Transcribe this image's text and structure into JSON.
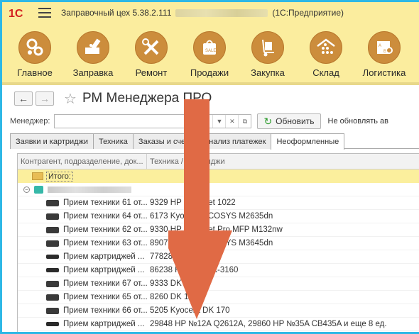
{
  "app": {
    "title": "Заправочный цех 5.38.2.111",
    "suffix": "(1С:Предприятие)"
  },
  "sections": [
    {
      "label": "Главное",
      "icon": "gears-icon"
    },
    {
      "label": "Заправка",
      "icon": "printer-refill-icon"
    },
    {
      "label": "Ремонт",
      "icon": "tools-icon"
    },
    {
      "label": "Продажи",
      "icon": "sale-bag-icon"
    },
    {
      "label": "Закупка",
      "icon": "hand-truck-icon"
    },
    {
      "label": "Склад",
      "icon": "warehouse-icon"
    },
    {
      "label": "Логистика",
      "icon": "map-pin-icon"
    }
  ],
  "form": {
    "title": "РМ Менеджера ПРО",
    "manager_label": "Менеджер:",
    "manager_value": "",
    "refresh_label": "Обновить",
    "no_update_label": "Не обновлять ав"
  },
  "tabs": [
    "Заявки и картриджи",
    "Техника",
    "Заказы и счета",
    "Анализ платежек",
    "Неоформленные"
  ],
  "active_tab": 4,
  "grid": {
    "columns": [
      "Контрагент, подразделение, док...",
      "Техника / Картриджи"
    ],
    "total_label": "Итого:",
    "rows": [
      {
        "doc": "Прием техники 61 от...",
        "item": "9329 HP LaserJet 1022",
        "type": "printer"
      },
      {
        "doc": "Прием техники 64 от...",
        "item": "6173 Kyocera ECOSYS M2635dn",
        "type": "printer"
      },
      {
        "doc": "Прием техники 62 от...",
        "item": "9330 HP LaserJet Pro MFP M132nw",
        "type": "printer"
      },
      {
        "doc": "Прием техники 63 от...",
        "item": "8907 Kyocera ECOSYS M3645dn",
        "type": "printer"
      },
      {
        "doc": "Прием картриджей ...",
        "item": "77828 HP CF218A",
        "type": "cartridge"
      },
      {
        "doc": "Прием картриджей ...",
        "item": "86238 Kyocera TK-3160",
        "type": "cartridge"
      },
      {
        "doc": "Прием техники 67 от...",
        "item": "9333 DK 1150",
        "type": "printer"
      },
      {
        "doc": "Прием техники 65 от...",
        "item": "8260 DK 1150",
        "type": "printer"
      },
      {
        "doc": "Прием техники 66 от...",
        "item": "5205 Kyocera DK 170",
        "type": "printer"
      },
      {
        "doc": "Прием картриджей ...",
        "item": "29848 HP №12A Q2612A, 29860 HP №35A CB435A и еще 8 ед.",
        "type": "cartridge"
      }
    ]
  },
  "colors": {
    "section_bg": "#fbed9e",
    "section_icon": "#cc8d3c",
    "frame": "#2eb8e6",
    "arrow": "#e06a45"
  }
}
